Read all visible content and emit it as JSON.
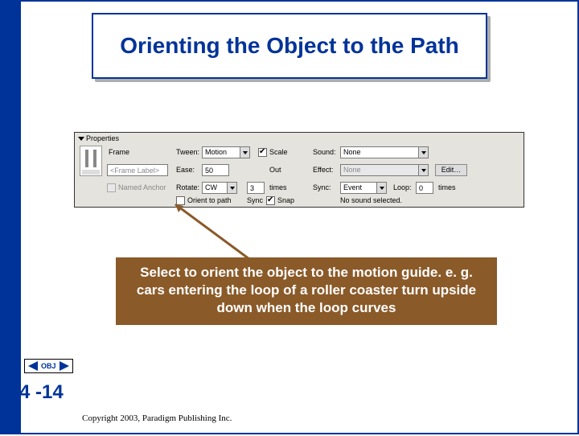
{
  "title": "Orienting the Object to the Path",
  "panel": {
    "header": "Properties",
    "frame_label": "Frame",
    "frame_label_input": "<Frame Label>",
    "named_anchor": "Named Anchor",
    "tween_label": "Tween:",
    "tween_value": "Motion",
    "ease_label": "Ease:",
    "ease_value": "50",
    "rotate_label": "Rotate:",
    "rotate_value": "CW",
    "rotate_times_value": "3",
    "times_label": "times",
    "orient_label": "Orient to path",
    "scale_label": "Scale",
    "out_label": "Out",
    "sync_label": "Sync",
    "snap_label": "Snap",
    "sound_label": "Sound:",
    "sound_value": "None",
    "effect_label": "Effect:",
    "effect_value": "None",
    "edit_button": "Edit…",
    "syncr_label": "Sync:",
    "syncr_value": "Event",
    "loop_label": "Loop:",
    "loop_value": "0",
    "loop_times": "times",
    "no_sound": "No sound selected."
  },
  "callout": "Select to orient the object to the motion guide. e. g. cars entering the loop of a roller coaster turn upside down when the loop curves",
  "nav_label": "OBJ",
  "page_number": "4 -14",
  "copyright": "Copyright 2003, Paradigm Publishing Inc."
}
